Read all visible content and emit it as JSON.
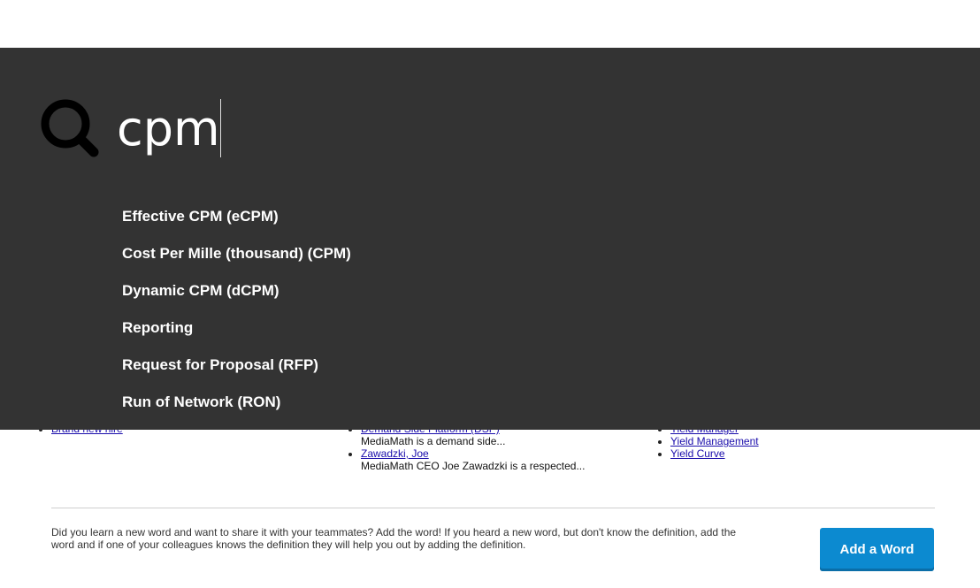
{
  "search": {
    "query": "cpm",
    "suggestions": [
      "Effective CPM (eCPM)",
      "Cost Per Mille (thousand) (CPM)",
      "Dynamic CPM (dCPM)",
      "Reporting",
      "Request for Proposal (RFP)",
      "Run of Network (RON)"
    ]
  },
  "columns": {
    "col1": [
      {
        "term": "Brand new hire"
      }
    ],
    "col2": [
      {
        "term": "Demand Side Platform (DSP)",
        "desc": "MediaMath is a demand side..."
      },
      {
        "term": "Zawadzki, Joe",
        "desc": "MediaMath CEO Joe Zawadzki is a respected..."
      }
    ],
    "col3": [
      {
        "term": "Yield Manager"
      },
      {
        "term": "Yield Management"
      },
      {
        "term": "Yield Curve"
      }
    ]
  },
  "footer": {
    "text": "Did you learn a new word and want to share it with your teammates? Add the word! If you heard a new word, but don't know the definition, add the word and if one of your colleagues knows the definition they will help you out by adding the definition.",
    "button_label": "Add a Word"
  },
  "colors": {
    "overlay": "#333333",
    "button": "#0c8ad0",
    "link": "#1a0dab"
  }
}
